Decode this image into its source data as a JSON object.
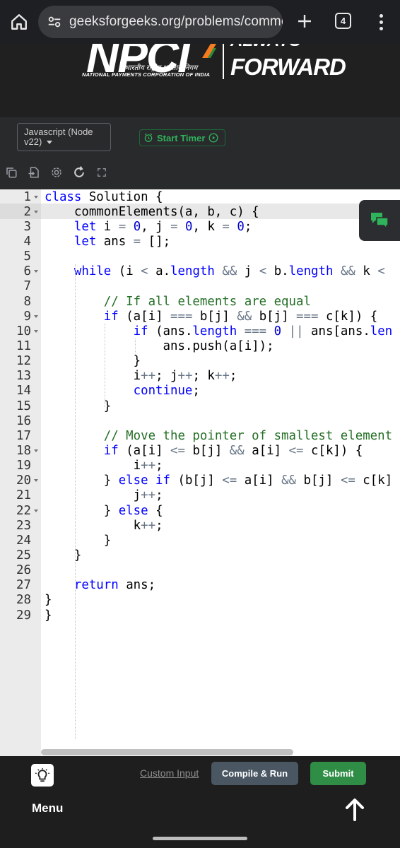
{
  "browser": {
    "url": "geeksforgeeks.org/problems/commor",
    "tab_count": "4"
  },
  "banner": {
    "logo": "NPCI",
    "hindi": "भारतीय राष्ट्रीय भुगतान निगम",
    "english": "NATIONAL PAYMENTS CORPORATION OF INDIA",
    "slogan_top": "ALWAYS",
    "slogan_bottom": "FORWARD"
  },
  "toolbar": {
    "language_label": "Javascript (Node v22)",
    "timer_label": "Start Timer"
  },
  "editor": {
    "line_numbers": [
      "1",
      "2",
      "3",
      "4",
      "5",
      "6",
      "7",
      "8",
      "9",
      "10",
      "11",
      "12",
      "13",
      "14",
      "15",
      "16",
      "17",
      "18",
      "19",
      "20",
      "21",
      "22",
      "23",
      "24",
      "25",
      "26",
      "27",
      "28",
      "29"
    ],
    "active_line": "2"
  },
  "footer": {
    "custom_input_label": "Custom Input",
    "compile_label": "Compile & Run",
    "submit_label": "Submit",
    "menu_label": "Menu"
  },
  "colors": {
    "accent_green": "#2f8d46",
    "timer_green": "#2fb35b",
    "keyword_blue": "#0000ff",
    "comment_green": "#236e24"
  }
}
